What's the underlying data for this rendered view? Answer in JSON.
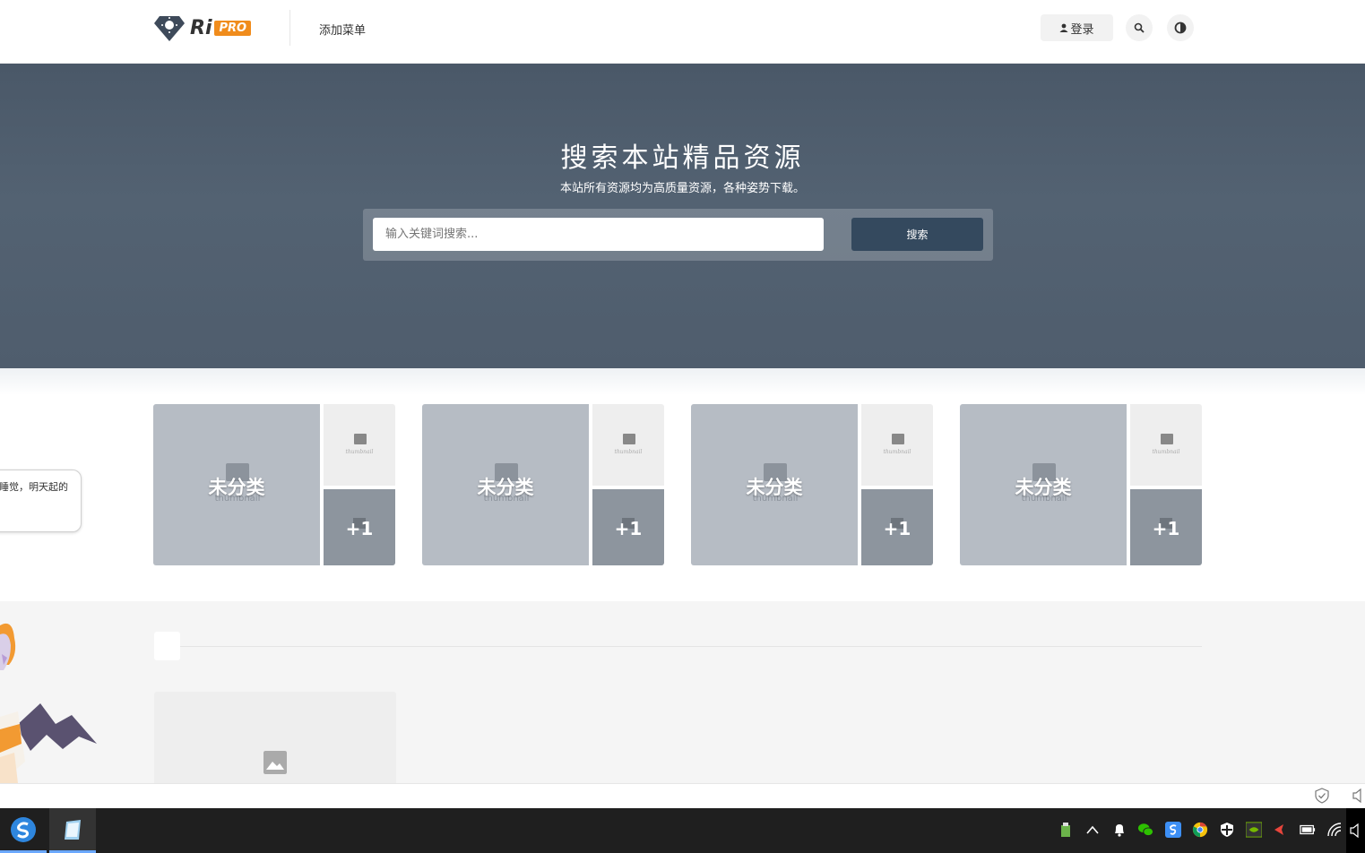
{
  "header": {
    "logo_text": "Ri",
    "logo_badge": "PRO",
    "menu_add": "添加菜单",
    "login_label": "登录",
    "search_icon": "search-icon",
    "theme_icon": "theme-toggle-icon"
  },
  "hero": {
    "title": "搜索本站精品资源",
    "subtitle": "本站所有资源均为高质量资源，各种姿势下载。",
    "search_placeholder": "输入关键词搜索...",
    "search_button": "搜索"
  },
  "categories": [
    {
      "name": "未分类",
      "thumb_text": "thumbnail",
      "count": "+1"
    },
    {
      "name": "未分类",
      "thumb_text": "thumbnail",
      "count": "+1"
    },
    {
      "name": "未分类",
      "thumb_text": "thumbnail",
      "count": "+1"
    },
    {
      "name": "未分类",
      "thumb_text": "thumbnail",
      "count": "+1"
    }
  ],
  "mascot": {
    "bubble_text": "睡觉，明天起的"
  },
  "colors": {
    "accent": "#f08c1c",
    "hero_bg": "#4f5d6d",
    "search_button_bg": "#34495e",
    "taskbar_bg": "#1f1f1f"
  }
}
